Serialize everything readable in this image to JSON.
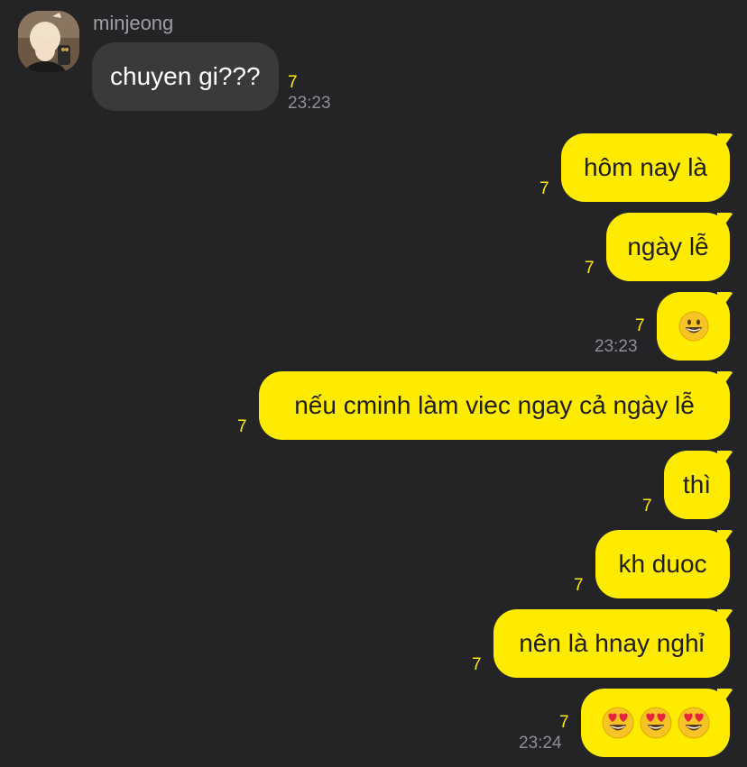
{
  "theme": {
    "background": "#242426",
    "incoming_bubble": "#3a3a3d",
    "outgoing_bubble": "#ffeb00",
    "unread_color": "#ffeb00"
  },
  "chat": {
    "sender": {
      "name": "minjeong",
      "avatar_icon": "profile-photo"
    },
    "incoming": [
      {
        "text": "chuyen gi???",
        "unread": "7",
        "time": "23:23"
      }
    ],
    "outgoing": [
      {
        "text": "hôm nay là",
        "unread": "7"
      },
      {
        "text": "ngày lễ",
        "unread": "7"
      },
      {
        "emoji": [
          "grinning-face"
        ],
        "unread": "7",
        "time": "23:23"
      },
      {
        "text": "nếu cminh làm viec ngay cả ngày lễ",
        "unread": "7"
      },
      {
        "text": "thì",
        "unread": "7"
      },
      {
        "text": "kh duoc",
        "unread": "7"
      },
      {
        "text": "nên là hnay nghỉ",
        "unread": "7"
      },
      {
        "emoji": [
          "heart-eyes-face",
          "heart-eyes-face",
          "heart-eyes-face"
        ],
        "unread": "7",
        "time": "23:24"
      }
    ]
  }
}
